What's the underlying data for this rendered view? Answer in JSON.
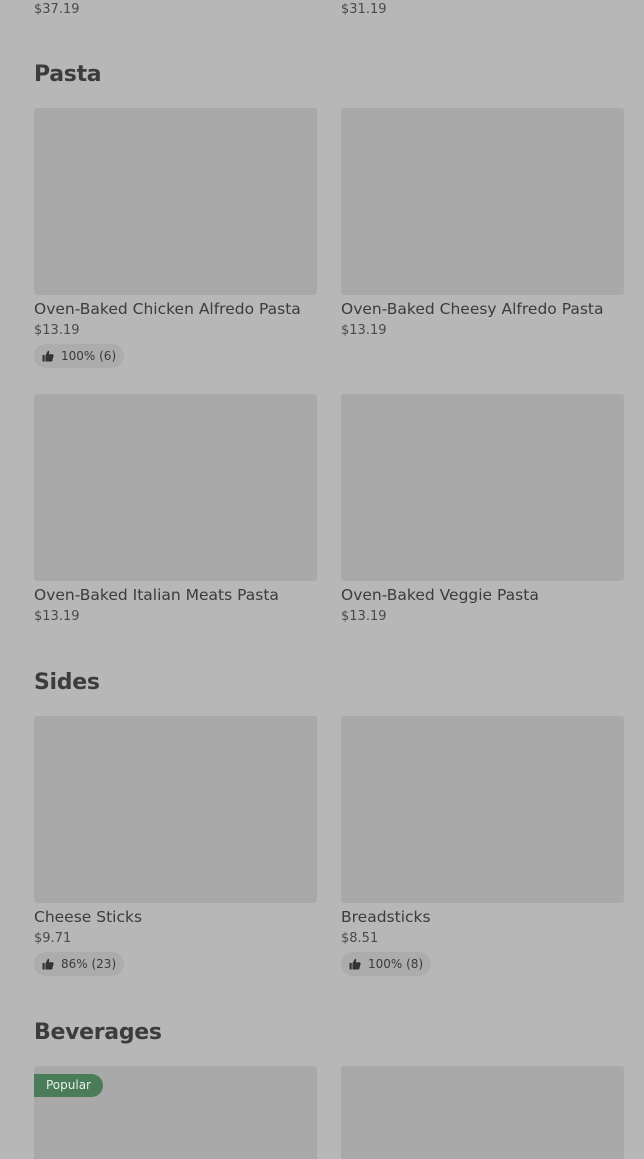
{
  "top_row": {
    "left_price": "$37.19",
    "right_price": "$31.19"
  },
  "sections": {
    "pasta": {
      "title": "Pasta",
      "items": [
        {
          "name": "Oven-Baked Chicken Alfredo Pasta",
          "price": "$13.19",
          "rating": "100% (6)"
        },
        {
          "name": "Oven-Baked Cheesy Alfredo Pasta",
          "price": "$13.19"
        },
        {
          "name": "Oven-Baked Italian Meats Pasta",
          "price": "$13.19"
        },
        {
          "name": "Oven-Baked Veggie Pasta",
          "price": "$13.19"
        }
      ]
    },
    "sides": {
      "title": "Sides",
      "items": [
        {
          "name": "Cheese Sticks",
          "price": "$9.71",
          "rating": "86% (23)"
        },
        {
          "name": "Breadsticks",
          "price": "$8.51",
          "rating": "100% (8)"
        }
      ]
    },
    "beverages": {
      "title": "Beverages",
      "items": [
        {
          "badge": "Popular"
        },
        {}
      ]
    }
  },
  "icons": {
    "rating": "thumbs-up-icon"
  },
  "colors": {
    "background": "#b7b7b7",
    "image_placeholder": "#a9a9a9",
    "badge": "#4a7c59"
  }
}
